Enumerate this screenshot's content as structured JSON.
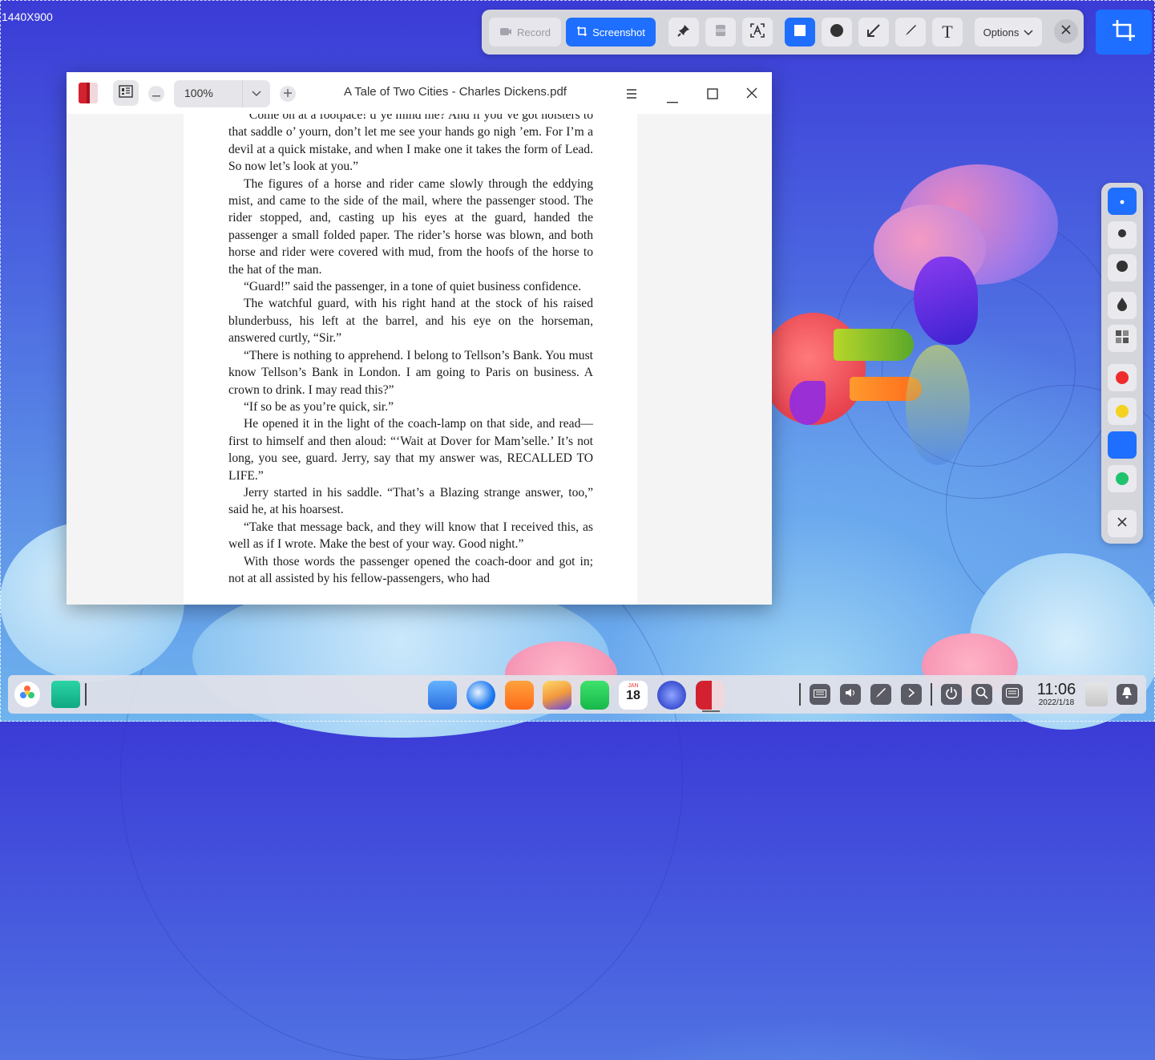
{
  "screen": {
    "dimension_label": "1440X900"
  },
  "capture_toolbar": {
    "record_label": "Record",
    "screenshot_label": "Screenshot",
    "options_label": "Options",
    "tools": [
      {
        "name": "pin-icon"
      },
      {
        "name": "blur-icon"
      },
      {
        "name": "ocr-icon"
      },
      {
        "name": "rectangle-icon"
      },
      {
        "name": "ellipse-icon"
      },
      {
        "name": "arrow-icon"
      },
      {
        "name": "pen-icon"
      },
      {
        "name": "text-icon",
        "glyph": "T"
      }
    ],
    "active_tool": "rectangle-icon",
    "accent_color": "#1e6fff"
  },
  "palette": {
    "sizes": [
      "small",
      "medium",
      "large"
    ],
    "effects": [
      "blur-drop",
      "mosaic"
    ],
    "colors": [
      "#ef2b2b",
      "#f4d21f",
      "#1e6fff",
      "#21c26e"
    ],
    "selected_color": "#1e6fff"
  },
  "viewer": {
    "title": "A Tale of Two Cities - Charles Dickens.pdf",
    "zoom": "100%",
    "paragraphs": [
      "“Come on at a footpace! d’ye mind me? And if you’ve got holsters to that saddle o’ yourn, don’t let me see your hands go nigh ’em. For I’m a devil at a quick mistake, and when I make one it takes the form of Lead. So now let’s look at you.”",
      "The figures of a horse and rider came slowly through the eddying mist, and came to the side of the mail, where the passenger stood. The rider stopped, and, casting up his eyes at the guard, handed the passenger a small folded paper. The rider’s horse was blown, and both horse and rider were covered with mud, from the hoofs of the horse to the hat of the man.",
      "“Guard!” said the passenger, in a tone of quiet business confidence.",
      "The watchful guard, with his right hand at the stock of his raised blunderbuss, his left at the barrel, and his eye on the horseman, answered curtly, “Sir.”",
      "“There is nothing to apprehend. I belong to Tellson’s Bank. You must know Tellson’s Bank in London. I am going to Paris on business. A crown to drink. I may read this?”",
      "“If so be as you’re quick, sir.”",
      "He opened it in the light of the coach-lamp on that side, and read—first to himself and then aloud: “‘Wait at Dover for Mam’selle.’ It’s not long, you see, guard. Jerry, say that my answer was, RECALLED TO LIFE.”",
      "Jerry started in his saddle. “That’s a Blazing strange answer, too,” said he, at his hoarsest.",
      "“Take that message back, and they will know that I received this, as well as if I wrote. Make the best of your way. Good night.”",
      "With those words the passenger opened the coach-door and got in; not at all assisted by his fellow-passengers, who had"
    ]
  },
  "dock": {
    "calendar_month": "JAN",
    "calendar_day": "18",
    "time": "11:06",
    "date": "2022/1/18"
  }
}
